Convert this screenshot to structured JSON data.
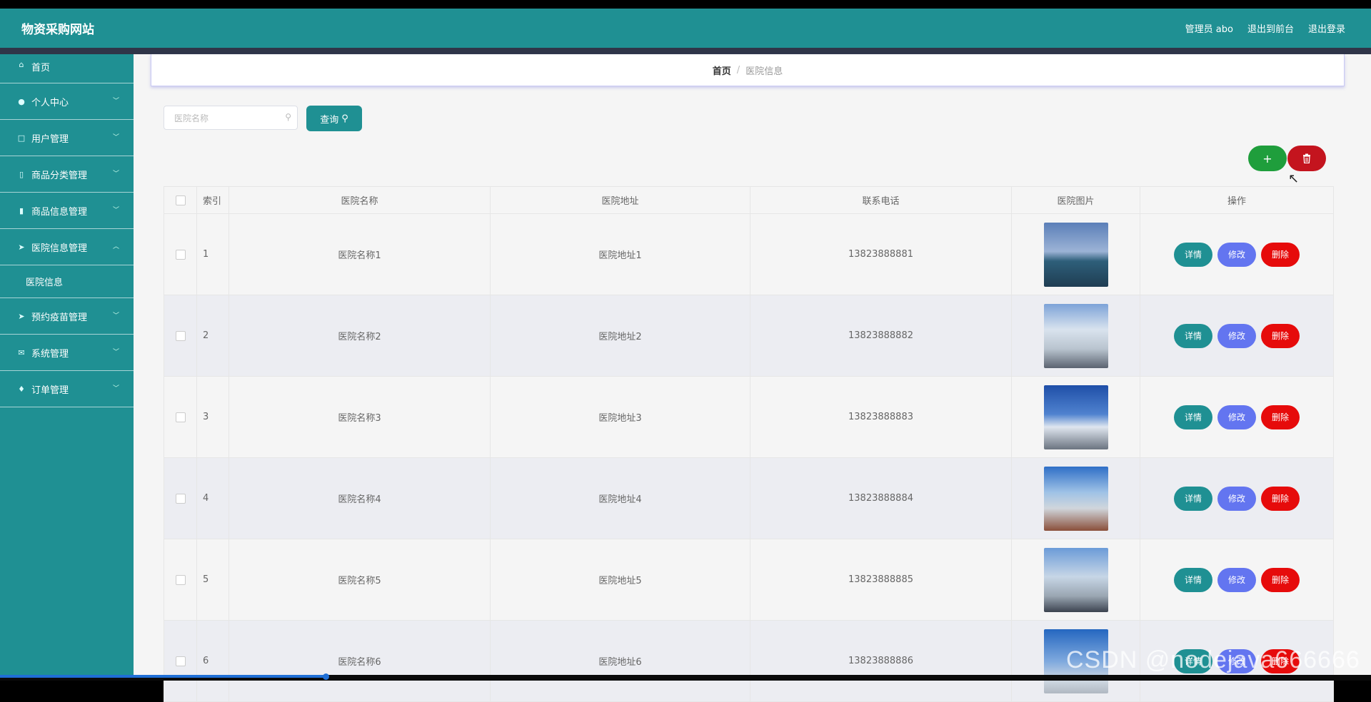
{
  "header": {
    "brand": "物资采购网站",
    "admin_label": "管理员 abo",
    "front_label": "退出到前台",
    "logout_label": "退出登录"
  },
  "sidebar": {
    "items": [
      {
        "label": "首页",
        "icon": "home-icon"
      },
      {
        "label": "个人中心",
        "icon": "user-icon"
      },
      {
        "label": "用户管理",
        "icon": "users-icon"
      },
      {
        "label": "商品分类管理",
        "icon": "category-icon"
      },
      {
        "label": "商品信息管理",
        "icon": "goods-icon"
      },
      {
        "label": "医院信息管理",
        "icon": "send-icon"
      },
      {
        "label": "预约疫苗管理",
        "icon": "send-icon"
      },
      {
        "label": "系统管理",
        "icon": "mail-icon"
      },
      {
        "label": "订单管理",
        "icon": "order-icon"
      }
    ],
    "sub_item": "医院信息"
  },
  "breadcrumb": {
    "home": "首页",
    "separator": "/",
    "current": "医院信息"
  },
  "search": {
    "placeholder": "医院名称",
    "button_label": "查询"
  },
  "actions": {
    "add_symbol": "+",
    "delete_icon": "trash-icon"
  },
  "table": {
    "headers": [
      "索引",
      "医院名称",
      "医院地址",
      "联系电话",
      "医院图片",
      "操作"
    ],
    "rows": [
      {
        "index": "1",
        "name": "医院名称1",
        "address": "医院地址1",
        "phone": "13823888881"
      },
      {
        "index": "2",
        "name": "医院名称2",
        "address": "医院地址2",
        "phone": "13823888882"
      },
      {
        "index": "3",
        "name": "医院名称3",
        "address": "医院地址3",
        "phone": "13823888883"
      },
      {
        "index": "4",
        "name": "医院名称4",
        "address": "医院地址4",
        "phone": "13823888884"
      },
      {
        "index": "5",
        "name": "医院名称5",
        "address": "医院地址5",
        "phone": "13823888885"
      },
      {
        "index": "6",
        "name": "医院名称6",
        "address": "医院地址6",
        "phone": "13823888886"
      }
    ],
    "op_labels": {
      "detail": "详情",
      "edit": "修改",
      "delete": "删除"
    }
  },
  "watermark": "CSDN @nodejava666666",
  "colors": {
    "primary": "#1f9093",
    "add": "#1f9e3c",
    "danger": "#e60b0b",
    "edit": "#6375f0"
  }
}
